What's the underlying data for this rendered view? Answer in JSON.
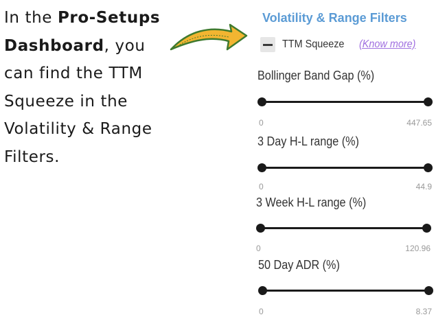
{
  "intro": {
    "prefix": "In the ",
    "emphasis": "Pro-Setups Dashboard",
    "suffix": ", you can find the TTM Squeeze in the Volatility & Range Filters."
  },
  "panel": {
    "title": "Volatility & Range Filters",
    "toggle": {
      "label": "TTM Squeeze",
      "link": "(Know more)",
      "state": "indeterminate"
    },
    "filters": [
      {
        "label": "Bollinger Band Gap (%)",
        "min": "0",
        "max": "447.65"
      },
      {
        "label": "3 Day H-L range (%)",
        "min": "0",
        "max": "44.9"
      },
      {
        "label": "3 Week H-L range (%)",
        "min": "0",
        "max": "120.96"
      },
      {
        "label": "50 Day ADR (%)",
        "min": "0",
        "max": "8.37"
      }
    ]
  },
  "colors": {
    "title": "#5b9bd5",
    "link": "#a070e0",
    "arrow_fill": "#f2b531",
    "arrow_stroke": "#3f7a2e"
  },
  "icons": {
    "arrow": "curved-arrow-right-icon",
    "toggle": "minus-checkbox-icon"
  }
}
